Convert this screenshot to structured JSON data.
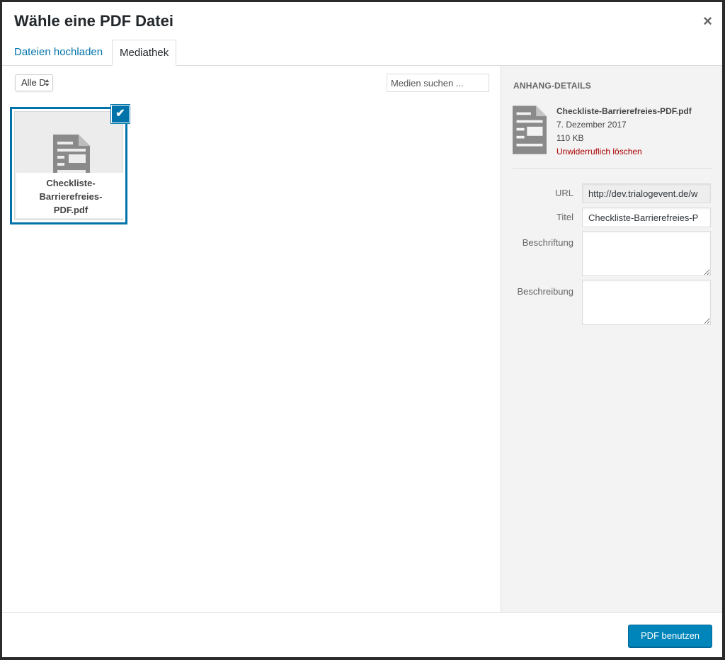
{
  "modal": {
    "title": "Wähle eine PDF Datei",
    "close_glyph": "×"
  },
  "tabs": [
    {
      "label": "Dateien hochladen",
      "active": false
    },
    {
      "label": "Mediathek",
      "active": true
    }
  ],
  "toolbar": {
    "filter_label": "Alle D",
    "filter_arrows": "▲▼",
    "search_placeholder": "Medien suchen ..."
  },
  "attachments": [
    {
      "filename_lines": [
        "Checkliste-",
        "Barrierefreies-",
        "PDF.pdf"
      ],
      "icon": "document-icon",
      "selected": true,
      "check_glyph": "✔"
    }
  ],
  "sidebar": {
    "heading": "Anhang-Details",
    "filename": "Checkliste-Barrierefreies-PDF.pdf",
    "date": "7. Dezember 2017",
    "size": "110 KB",
    "delete_label": "Unwiderruflich löschen",
    "fields": {
      "url_label": "URL",
      "url_value": "http://dev.trialogevent.de/w",
      "title_label": "Titel",
      "title_value": "Checkliste-Barrierefreies-P",
      "caption_label": "Beschriftung",
      "caption_value": "",
      "description_label": "Beschreibung",
      "description_value": ""
    }
  },
  "footer": {
    "primary_label": "PDF benutzen"
  },
  "colors": {
    "accent": "#0073aa",
    "primary_button": "#0085ba",
    "delete": "#aa0000",
    "sidebar_bg": "#f3f3f3"
  }
}
